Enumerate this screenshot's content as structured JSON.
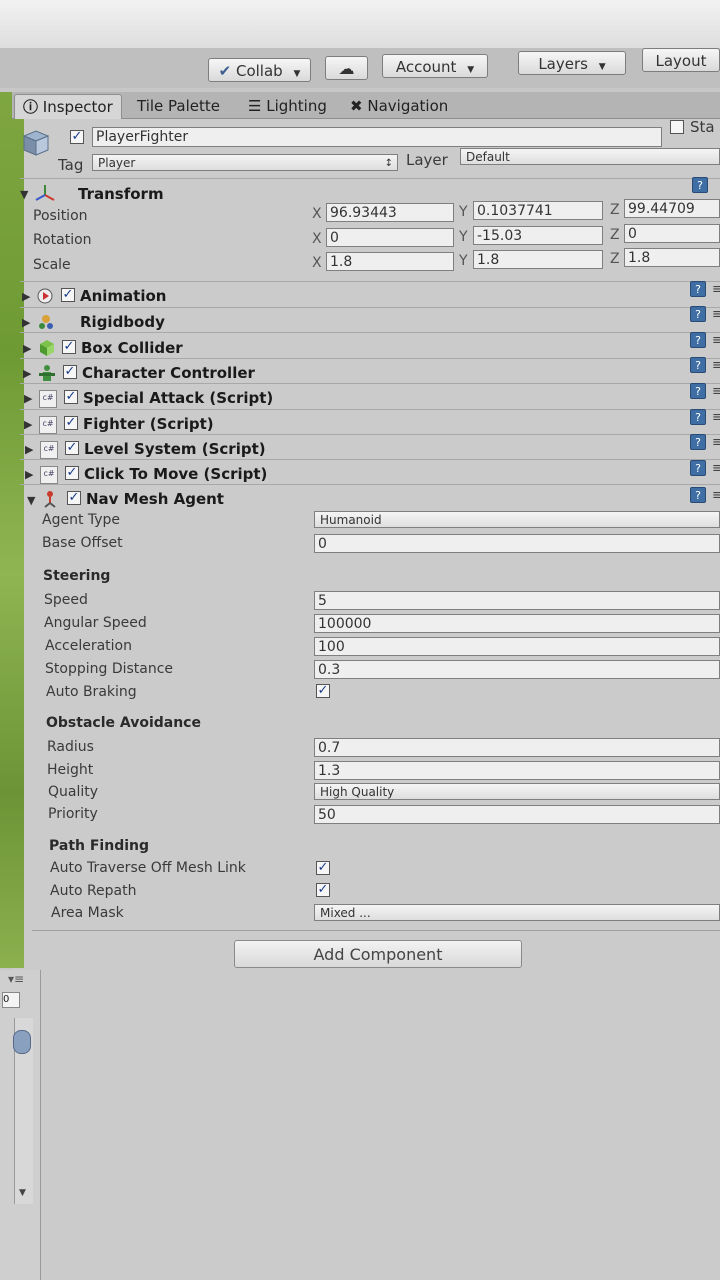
{
  "toolbar": {
    "collab": "Collab",
    "account": "Account",
    "layers": "Layers",
    "layout": "Layout"
  },
  "tabs": [
    "Inspector",
    "Tile Palette",
    "Lighting",
    "Navigation"
  ],
  "object": {
    "name": "PlayerFighter",
    "static_label": "Sta",
    "tag_label": "Tag",
    "tag": "Player",
    "layer_label": "Layer",
    "layer": "Default"
  },
  "transform": {
    "title": "Transform",
    "position": {
      "label": "Position",
      "x": "96.93443",
      "y": "0.1037741",
      "z": "99.44709"
    },
    "rotation": {
      "label": "Rotation",
      "x": "0",
      "y": "-15.03",
      "z": "0"
    },
    "scale": {
      "label": "Scale",
      "x": "1.8",
      "y": "1.8",
      "z": "1.8"
    }
  },
  "axes": {
    "x": "X",
    "y": "Y",
    "z": "Z"
  },
  "components": [
    "Animation",
    "Rigidbody",
    "Box Collider",
    "Character Controller",
    "Special Attack (Script)",
    "Fighter (Script)",
    "Level System (Script)",
    "Click To Move (Script)"
  ],
  "nav": {
    "title": "Nav Mesh Agent",
    "agent_type_label": "Agent Type",
    "agent_type": "Humanoid",
    "base_offset_label": "Base Offset",
    "base_offset": "0",
    "steering": "Steering",
    "speed_label": "Speed",
    "speed": "5",
    "angular_label": "Angular Speed",
    "angular": "100000",
    "accel_label": "Acceleration",
    "accel": "100",
    "stop_label": "Stopping Distance",
    "stop": "0.3",
    "braking_label": "Auto Braking",
    "obstacle": "Obstacle Avoidance",
    "radius_label": "Radius",
    "radius": "0.7",
    "height_label": "Height",
    "height": "1.3",
    "quality_label": "Quality",
    "quality": "High Quality",
    "priority_label": "Priority",
    "priority": "50",
    "pathfinding": "Path Finding",
    "traverse_label": "Auto Traverse Off Mesh Link",
    "repath_label": "Auto Repath",
    "area_label": "Area Mask",
    "area": "Mixed ..."
  },
  "add_component": "Add Component",
  "hier_value": "0"
}
